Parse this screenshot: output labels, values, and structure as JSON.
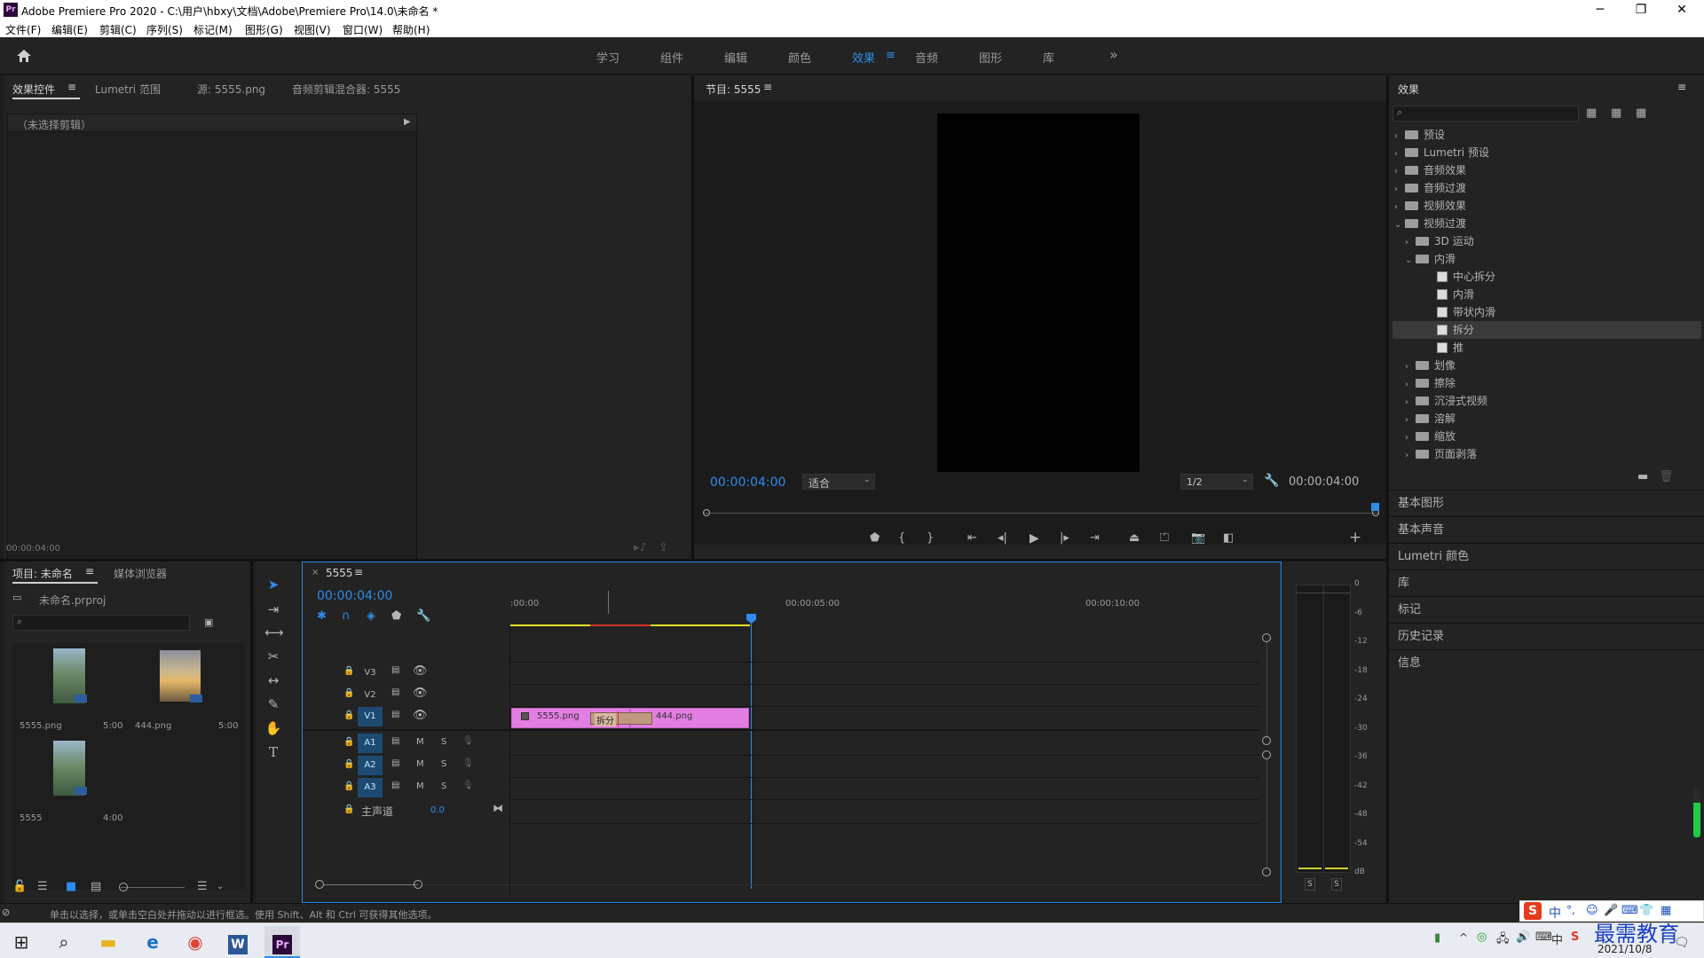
{
  "window": {
    "title": "Adobe Premiere Pro 2020 - C:\\用户\\hbxy\\文档\\Adobe\\Premiere Pro\\14.0\\未命名 *",
    "app_badge": "Pr",
    "minimize": "─",
    "maximize": "❐",
    "close": "✕"
  },
  "menu": [
    "文件(F)",
    "编辑(E)",
    "剪辑(C)",
    "序列(S)",
    "标记(M)",
    "图形(G)",
    "视图(V)",
    "窗口(W)",
    "帮助(H)"
  ],
  "workspaces": {
    "items": [
      "学习",
      "组件",
      "编辑",
      "颜色",
      "效果",
      "音频",
      "图形",
      "库"
    ],
    "active_index": 4,
    "more": "»"
  },
  "source_panel": {
    "tabs": [
      "效果控件",
      "Lumetri 范围",
      "源: 5555.png",
      "音频剪辑混合器: 5555"
    ],
    "no_clip": "（未选择剪辑）",
    "timecode": "00:00:04:00"
  },
  "program_monitor": {
    "title": "节目: 5555",
    "timecode_left": "00:00:04:00",
    "fit": "适合",
    "resolution": "1/2",
    "timecode_right": "00:00:04:00",
    "playhead_fraction": 1.0
  },
  "effects_panel": {
    "title": "效果",
    "search_placeholder": "",
    "tree": [
      {
        "label": "预设",
        "level": 0,
        "type": "folder-special",
        "open": false
      },
      {
        "label": "Lumetri 预设",
        "level": 0,
        "type": "folder-special",
        "open": false
      },
      {
        "label": "音频效果",
        "level": 0,
        "type": "folder",
        "open": false
      },
      {
        "label": "音频过渡",
        "level": 0,
        "type": "folder",
        "open": false
      },
      {
        "label": "视频效果",
        "level": 0,
        "type": "folder",
        "open": false
      },
      {
        "label": "视频过渡",
        "level": 0,
        "type": "folder",
        "open": true
      },
      {
        "label": "3D 运动",
        "level": 1,
        "type": "folder",
        "open": false
      },
      {
        "label": "内滑",
        "level": 1,
        "type": "folder",
        "open": true
      },
      {
        "label": "中心拆分",
        "level": 2,
        "type": "effect"
      },
      {
        "label": "内滑",
        "level": 2,
        "type": "effect"
      },
      {
        "label": "带状内滑",
        "level": 2,
        "type": "effect"
      },
      {
        "label": "拆分",
        "level": 2,
        "type": "effect",
        "selected": true
      },
      {
        "label": "推",
        "level": 2,
        "type": "effect"
      },
      {
        "label": "划像",
        "level": 1,
        "type": "folder",
        "open": false
      },
      {
        "label": "擦除",
        "level": 1,
        "type": "folder",
        "open": false
      },
      {
        "label": "沉浸式视频",
        "level": 1,
        "type": "folder",
        "open": false
      },
      {
        "label": "溶解",
        "level": 1,
        "type": "folder",
        "open": false
      },
      {
        "label": "缩放",
        "level": 1,
        "type": "folder",
        "open": false
      },
      {
        "label": "页面剥落",
        "level": 1,
        "type": "folder",
        "open": false
      }
    ]
  },
  "side_panels": [
    "基本图形",
    "基本声音",
    "Lumetri 颜色",
    "库",
    "标记",
    "历史记录",
    "信息"
  ],
  "project_panel": {
    "tabs": [
      "项目: 未命名",
      "媒体浏览器"
    ],
    "project_file": "未命名.prproj",
    "items": [
      {
        "name": "5555.png",
        "duration": "5:00"
      },
      {
        "name": "444.png",
        "duration": "5:00"
      },
      {
        "name": "5555",
        "duration": "4:00"
      }
    ]
  },
  "timeline": {
    "sequence_name": "5555",
    "timecode": "00:00:04:00",
    "ruler": [
      ":00:00",
      "00:00:05:00",
      "00:00:10:00"
    ],
    "video_tracks": [
      "V3",
      "V2",
      "V1"
    ],
    "audio_tracks": [
      "A1",
      "A2",
      "A3"
    ],
    "mute": "M",
    "solo": "S",
    "master": {
      "label": "主声道",
      "value": "0.0"
    },
    "clips": [
      {
        "name": "5555.png"
      },
      {
        "name": "444.png"
      }
    ],
    "transition": "拆分"
  },
  "audio_meter": {
    "ticks": [
      "0",
      "-6",
      "-12",
      "-18",
      "-24",
      "-30",
      "-36",
      "-42",
      "-48",
      "-54",
      "dB"
    ],
    "solo_left": "S",
    "solo_right": "S"
  },
  "status_bar": {
    "text": "单击以选择，或单击空白处并拖动以进行框选。使用 Shift、Alt 和 Ctrl 可获得其他选项。"
  },
  "taskbar": {
    "date": "2021/10/8",
    "watermark": "最需教育",
    "ime": "中"
  },
  "colors": {
    "accent": "#2d8ceb",
    "clip": "#e37ee3",
    "selected_bg": "#3a3a3a"
  }
}
